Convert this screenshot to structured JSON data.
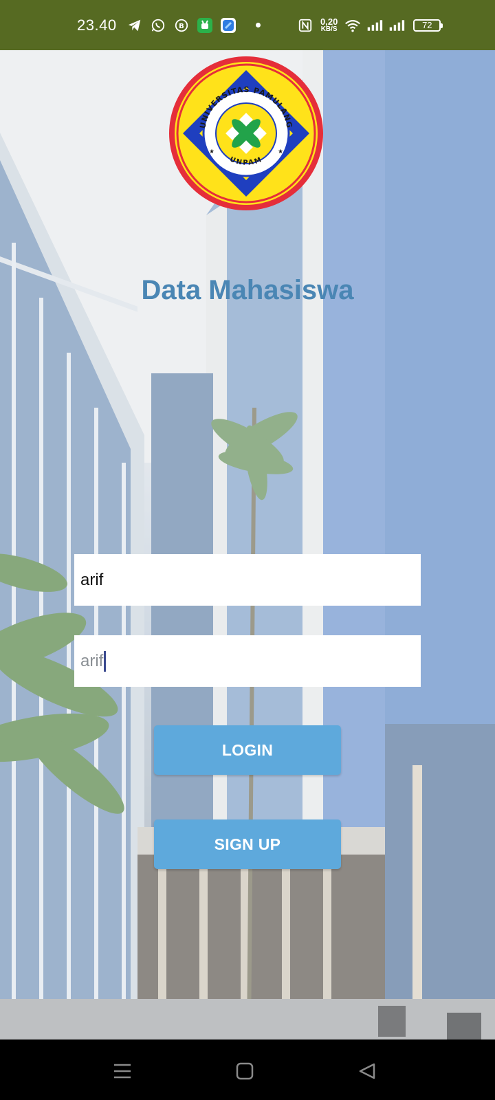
{
  "status_bar": {
    "time": "23.40",
    "net_speed_value": "0,20",
    "net_speed_unit": "KB/S",
    "battery": "72",
    "icons": [
      "telegram-icon",
      "whatsapp-icon",
      "business-icon",
      "app-green-icon",
      "app-blue-icon",
      "nfc-icon",
      "wifi-icon",
      "signal-icon",
      "signal-icon",
      "battery-icon"
    ]
  },
  "logo": {
    "ring_text_top": "UNIVERSITAS PAMULANG",
    "ring_text_bottom": "UNPAM"
  },
  "app": {
    "title": "Data Mahasiswa"
  },
  "form": {
    "username_value": "arif",
    "password_value": "arif",
    "login_label": "LOGIN",
    "signup_label": "SIGN UP"
  },
  "colors": {
    "status_bar": "#566a22",
    "title": "#4a86b4",
    "button": "#5ea9dc",
    "logo_ring": "#e52e3a",
    "logo_fill": "#ffe21a",
    "logo_star": "#1f3fbf"
  },
  "nav_bar": {
    "icons": [
      "menu-icon",
      "home-square-icon",
      "back-triangle-icon"
    ]
  }
}
